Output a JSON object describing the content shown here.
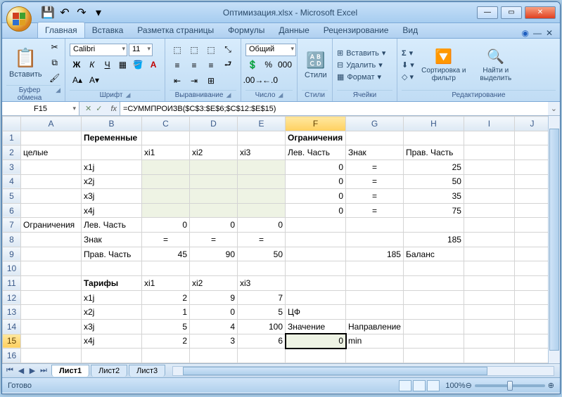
{
  "title": "Оптимизация.xlsx - Microsoft Excel",
  "qat": {
    "save": "💾",
    "undo": "↶",
    "redo": "↷",
    "dd": "▾"
  },
  "tabs": [
    "Главная",
    "Вставка",
    "Разметка страницы",
    "Формулы",
    "Данные",
    "Рецензирование",
    "Вид"
  ],
  "active_tab": 0,
  "ribbon": {
    "clipboard": {
      "label": "Буфер обмена",
      "paste": "Вставить"
    },
    "font": {
      "label": "Шрифт",
      "name": "Calibri",
      "size": "11"
    },
    "align": {
      "label": "Выравнивание"
    },
    "number": {
      "label": "Число",
      "format": "Общий"
    },
    "styles": {
      "label": "Стили",
      "btn": "Стили"
    },
    "cells": {
      "label": "Ячейки",
      "insert": "Вставить",
      "delete": "Удалить",
      "format": "Формат"
    },
    "editing": {
      "label": "Редактирование",
      "sort": "Сортировка и фильтр",
      "find": "Найти и выделить"
    }
  },
  "namebox": "F15",
  "formula": "=СУММПРОИЗВ($C$3:$E$6;$C$12:$E$15)",
  "columns": [
    "A",
    "B",
    "C",
    "D",
    "E",
    "F",
    "G",
    "H",
    "I",
    "J"
  ],
  "rows": 16,
  "cells": {
    "B1": "Переменные",
    "F1": "Ограничения",
    "A2": "целые",
    "C2": "xi1",
    "D2": "xi2",
    "E2": "xi3",
    "F2": "Лев. Часть",
    "G2": "Знак",
    "H2": "Прав. Часть",
    "B3": "x1j",
    "F3": "0",
    "G3": "=",
    "H3": "25",
    "B4": "x2j",
    "F4": "0",
    "G4": "=",
    "H4": "50",
    "B5": "x3j",
    "F5": "0",
    "G5": "=",
    "H5": "35",
    "B6": "x4j",
    "F6": "0",
    "G6": "=",
    "H6": "75",
    "A7": "Ограничения",
    "B7": "Лев. Часть",
    "C7": "0",
    "D7": "0",
    "E7": "0",
    "B8": "Знак",
    "C8": "=",
    "D8": "=",
    "E8": "=",
    "H8": "185",
    "B9": "Прав. Часть",
    "C9": "45",
    "D9": "90",
    "E9": "50",
    "G9": "185",
    "H9": "Баланс",
    "B11": "Тарифы",
    "C11": "xi1",
    "D11": "xi2",
    "E11": "xi3",
    "B12": "x1j",
    "C12": "2",
    "D12": "9",
    "E12": "7",
    "B13": "x2j",
    "C13": "1",
    "D13": "0",
    "E13": "5",
    "F13": "ЦФ",
    "B14": "x3j",
    "C14": "5",
    "D14": "4",
    "E14": "100",
    "F14": "Значение",
    "G14": "Направление",
    "B15": "x4j",
    "C15": "2",
    "D15": "3",
    "E15": "6",
    "F15": "0",
    "G15": "min"
  },
  "numeric_cells": [
    "F3",
    "H3",
    "F4",
    "H4",
    "F5",
    "H5",
    "F6",
    "H6",
    "C7",
    "D7",
    "E7",
    "H8",
    "C9",
    "D9",
    "E9",
    "G9",
    "C12",
    "D12",
    "E12",
    "C13",
    "D13",
    "E13",
    "C14",
    "D14",
    "E14",
    "C15",
    "D15",
    "E15",
    "F15"
  ],
  "center_cells": [
    "G3",
    "G4",
    "G5",
    "G6",
    "C8",
    "D8",
    "E8"
  ],
  "bold_cells": [
    "B1",
    "F1",
    "B11"
  ],
  "shaded_cells": [
    "C3",
    "D3",
    "E3",
    "C4",
    "D4",
    "E4",
    "C5",
    "D5",
    "E5",
    "C6",
    "D6",
    "E6"
  ],
  "active_cell": "F15",
  "sheets": [
    "Лист1",
    "Лист2",
    "Лист3"
  ],
  "active_sheet": 0,
  "status": "Готово",
  "zoom": "100%"
}
